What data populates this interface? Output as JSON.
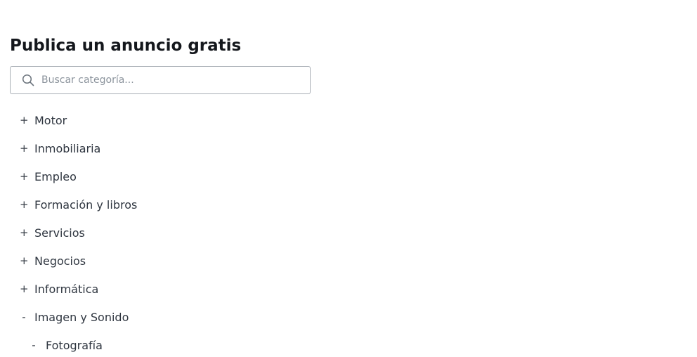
{
  "heading": "Publica un anuncio gratis",
  "search": {
    "placeholder": "Buscar categoría...",
    "value": "",
    "icon": "search-icon"
  },
  "categories": [
    {
      "toggle": "+",
      "label": "Motor",
      "expanded": false
    },
    {
      "toggle": "+",
      "label": "Inmobiliaria",
      "expanded": false
    },
    {
      "toggle": "+",
      "label": "Empleo",
      "expanded": false
    },
    {
      "toggle": "+",
      "label": "Formación y libros",
      "expanded": false
    },
    {
      "toggle": "+",
      "label": "Servicios",
      "expanded": false
    },
    {
      "toggle": "+",
      "label": "Negocios",
      "expanded": false
    },
    {
      "toggle": "+",
      "label": "Informática",
      "expanded": false
    },
    {
      "toggle": "-",
      "label": "Imagen y Sonido",
      "expanded": true,
      "children": [
        {
          "toggle": "-",
          "label": "Fotografía",
          "expanded": true
        }
      ]
    }
  ],
  "colors": {
    "heading": "#14171c",
    "text": "#2f3640",
    "placeholder": "#8b939c",
    "border": "#a9afb6"
  }
}
